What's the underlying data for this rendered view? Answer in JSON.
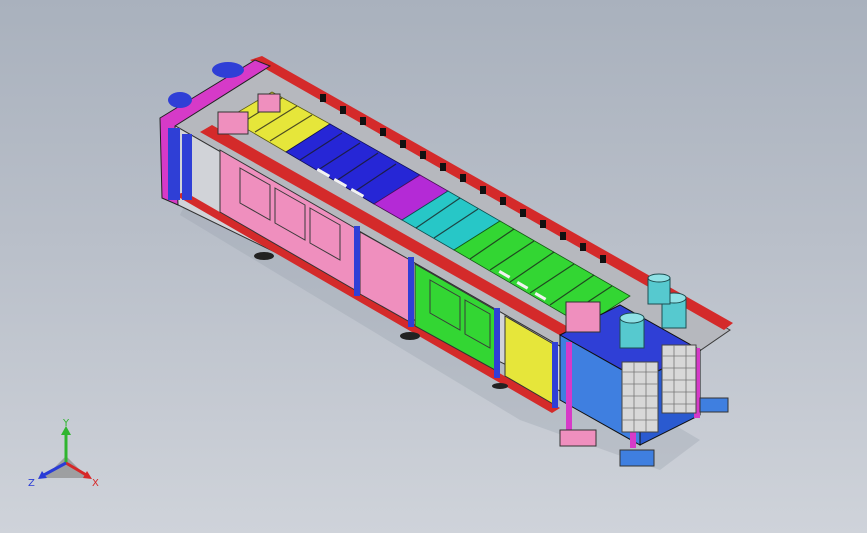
{
  "colors": {
    "background_top": "#a9b1bd",
    "background_bottom": "#cfd3da",
    "frame_red": "#d42a2a",
    "frame_blue": "#2f3fd6",
    "panel_pink": "#ef8fbe",
    "panel_magenta": "#d63ac8",
    "zone_yellow": "#e6e63a",
    "zone_blue": "#2626d6",
    "zone_magenta": "#b42ad6",
    "zone_cyan": "#27c7c7",
    "zone_green": "#33d633",
    "motor_cyan": "#56c9cf",
    "bracket_black": "#111111"
  },
  "triad": {
    "x_label": "X",
    "y_label": "Y",
    "z_label": "Z",
    "x_color": "#d62828",
    "y_color": "#2fb52f",
    "z_color": "#2a3cd6"
  }
}
